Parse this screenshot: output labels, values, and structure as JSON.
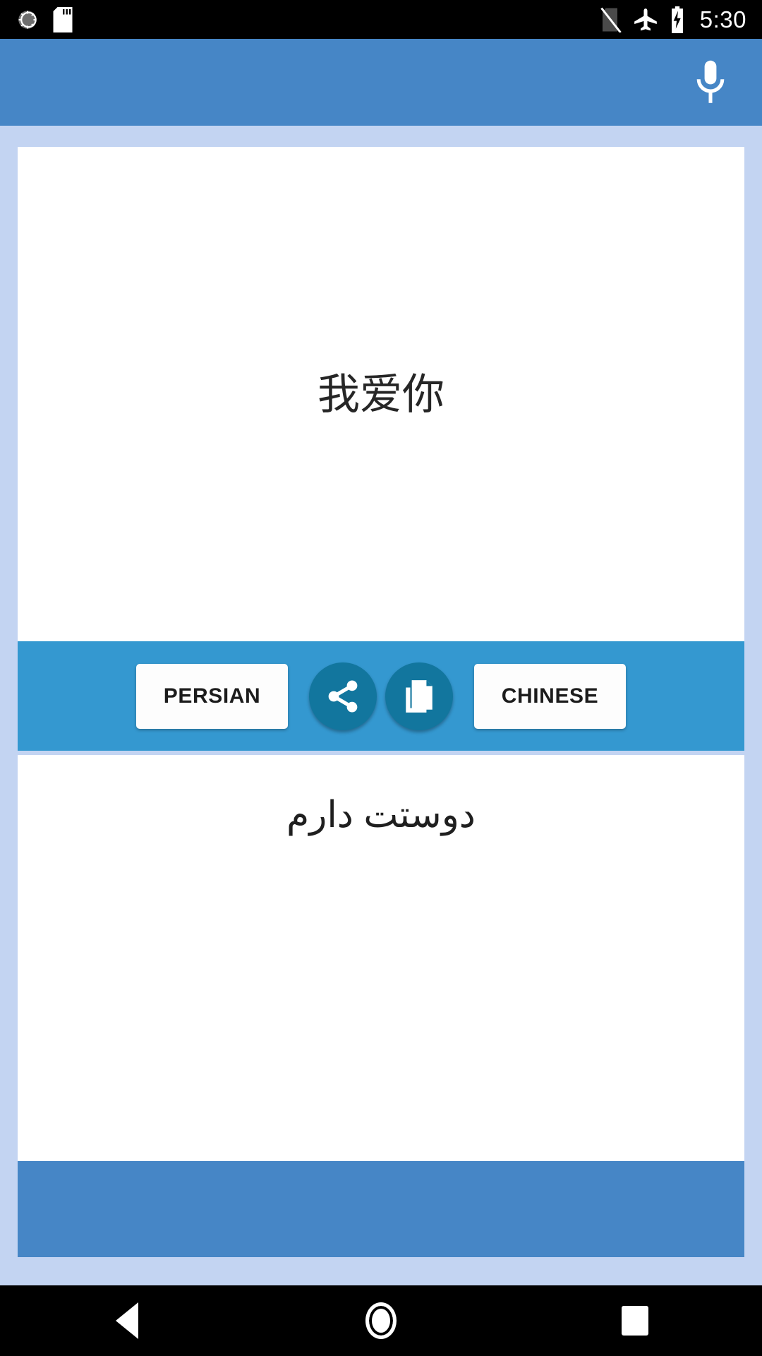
{
  "status_bar": {
    "left_icons": [
      {
        "name": "sync-icon",
        "label": "sync"
      },
      {
        "name": "sd-card-icon",
        "label": "sd card"
      }
    ],
    "right_icons": [
      {
        "name": "no-sim-card-icon",
        "label": "no sim card"
      },
      {
        "name": "airplane-mode-icon",
        "label": "airplane mode"
      },
      {
        "name": "battery-charging-icon",
        "label": "battery charging"
      }
    ],
    "time": "5:30"
  },
  "toolbar": {
    "mic_icon": "microphone-icon",
    "background_color": "#4686c6"
  },
  "translation": {
    "source_text": "我爱你",
    "target_text": "دوستت دارم"
  },
  "controls": {
    "source_language_label": "PERSIAN",
    "target_language_label": "CHINESE",
    "share_icon": "share-icon",
    "copy_icon": "copy-icon",
    "bar_color": "#3498d0",
    "round_button_color": "#12769e"
  },
  "nav_bar": {
    "back_label": "back",
    "home_label": "home",
    "recents_label": "recents"
  },
  "colors": {
    "page_background": "#c3d4f2",
    "card_background": "#ffffff",
    "accent": "#4686c6"
  }
}
